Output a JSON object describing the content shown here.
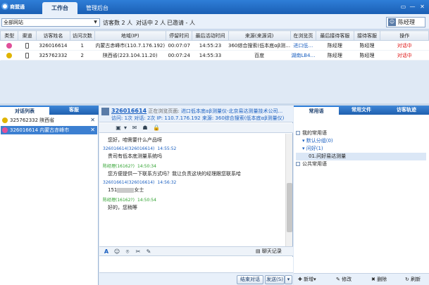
{
  "app": {
    "title": "商盟通"
  },
  "top_tabs": [
    "工作台",
    "管理后台"
  ],
  "window_buttons": [
    "▭",
    "—",
    "✕"
  ],
  "toolbar": {
    "site_select": "全部网站",
    "visitor_count": "访客数 2 人",
    "chatting_count": "对话中 2 人",
    "invited_count": "已邀请 - 人",
    "user": "陈经理"
  },
  "visitor_table": {
    "headers": [
      "类型",
      "渠道",
      "访客姓名",
      "访问次数",
      "地域(IP)",
      "停留时间",
      "最后活动时间",
      "来源(来源词)",
      "在浏览页",
      "最后接待客服",
      "接待客服",
      "操作"
    ],
    "rows": [
      {
        "id": "326016614",
        "visits": "1",
        "region": "内蒙古赤峰市(110.7.176.192)",
        "stay": "00:07:07",
        "last_active": "14:55:23",
        "source": "360综合搜索(低本底αβ测…",
        "page": "进口低…",
        "last_agent": "陈经理",
        "agent": "陈经理",
        "status": "对话中",
        "type_color": "#e0509a"
      },
      {
        "id": "325762332",
        "visits": "2",
        "region": "陕西省(223.104.11.20)",
        "stay": "00:07:24",
        "last_active": "14:55:33",
        "source": "百度",
        "page": "湖南LB4…",
        "last_agent": "陈经理",
        "agent": "陈经理",
        "status": "对话中",
        "type_color": "#e0b400"
      }
    ]
  },
  "left_tabs": [
    "对话列表",
    "客服"
  ],
  "conversations": [
    {
      "label": "325762332 陕西省",
      "color": "#e0b400",
      "close": "✕"
    },
    {
      "label": "326016614 内蒙古赤峰市",
      "color": "#e0509a",
      "close": "✕"
    }
  ],
  "chat_header": {
    "visitor_id": "326016614",
    "browsing_label": "正在浏览页面:",
    "browsing_page": "进口低本底αβ测量仪-北京易达测量技术公司...",
    "stats": "访问: 1次 对话: 2次 IP: 110.7.176.192 来源: 360综合搜索(低本底αβ测量仪)"
  },
  "chat_tools": [
    "▣",
    "▾",
    "✉",
    "☗",
    "🔒"
  ],
  "messages": [
    {
      "kind": "text",
      "text": "您好，咱需要什么产品呀"
    },
    {
      "kind": "header",
      "role": "visitor",
      "name": "326016614(326016614)",
      "time": "14:55:52"
    },
    {
      "kind": "text",
      "text": "贵司有低本底测量系统吗"
    },
    {
      "kind": "header",
      "role": "agent",
      "name": "陈经理(16162?)",
      "time": "14:50:34"
    },
    {
      "kind": "text",
      "text": "您方便提供一下联系方式吗？我让负责这块的经理跟您联系哈"
    },
    {
      "kind": "header",
      "role": "visitor",
      "name": "326016614(326016614)",
      "time": "14:56:32"
    },
    {
      "kind": "masked",
      "prefix": "151",
      "suffix": "女士"
    },
    {
      "kind": "header",
      "role": "agent",
      "name": "陈经理(16162?)",
      "time": "14:50:54"
    },
    {
      "kind": "text",
      "text": "好的，您稍等"
    }
  ],
  "chat_bar": {
    "icons": [
      "A",
      "☺",
      "⌾",
      "✂",
      "✎"
    ],
    "history": "聊天记录"
  },
  "chat_footer": {
    "end": "结束对话",
    "send": "发送(S)",
    "send_arrow": "▾"
  },
  "right_tabs": [
    "常用语",
    "常用文件",
    "访客轨迹"
  ],
  "phrase_tree": [
    {
      "label": "我的常用语",
      "level": 0,
      "box": true
    },
    {
      "label": "默认分组(0)",
      "level": 1,
      "link": true
    },
    {
      "label": "问好(1)",
      "level": 1,
      "link": true
    },
    {
      "label": "01.问好易达测量",
      "level": 2,
      "sel": true
    },
    {
      "label": "公共常用语",
      "level": 0,
      "box": true
    }
  ],
  "right_footer": {
    "add": "新增",
    "edit": "修改",
    "delete": "删除",
    "refresh": "刷新"
  }
}
